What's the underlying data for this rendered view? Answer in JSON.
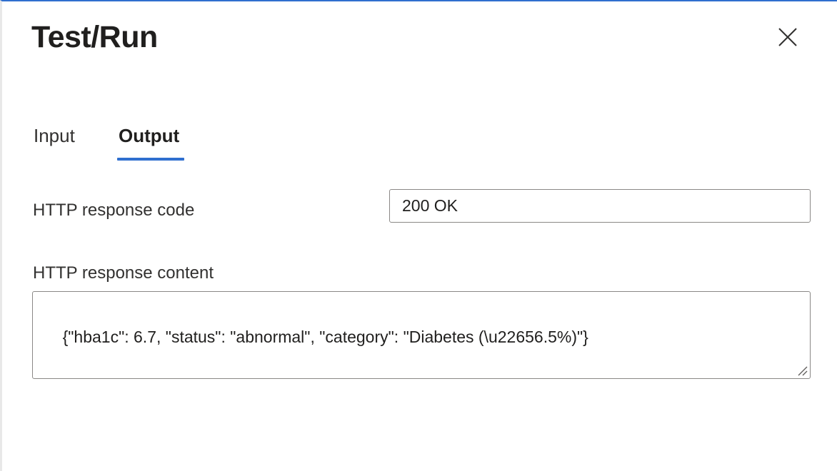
{
  "panel": {
    "title": "Test/Run",
    "close_icon": "close-icon"
  },
  "tabs": [
    {
      "label": "Input",
      "selected": false
    },
    {
      "label": "Output",
      "selected": true
    }
  ],
  "response_code": {
    "label": "HTTP response code",
    "value": "200 OK"
  },
  "response_content": {
    "label": "HTTP response content",
    "value": "{\"hba1c\": 6.7, \"status\": \"abnormal\", \"category\": \"Diabetes (\\u22656.5%)\"}"
  },
  "colors": {
    "accent": "#2f6fcf",
    "border": "#8a8886",
    "text": "#323130"
  }
}
